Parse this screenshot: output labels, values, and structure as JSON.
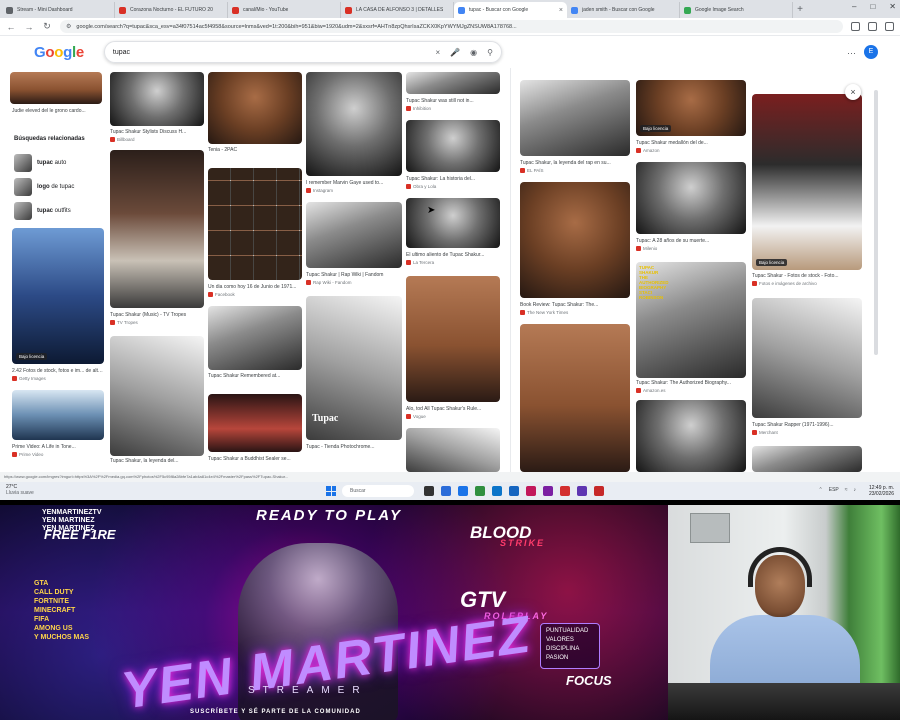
{
  "browser": {
    "tabs": [
      {
        "label": "Stream - Mini Dashboard",
        "color": "#5f6368"
      },
      {
        "label": "Corazona Nocturno - EL FUTURO 20",
        "color": "#d93025"
      },
      {
        "label": "canal/Mio - YouTube",
        "color": "#d93025"
      },
      {
        "label": "LA CASA DE ALFONSO 3 | DETALLES",
        "color": "#d93025"
      },
      {
        "label": "tupac - Buscar con Google",
        "color": "#4285f4",
        "active": true
      },
      {
        "label": "jaden smith - Buscar con Google",
        "color": "#4285f4"
      },
      {
        "label": "Google Image Search",
        "color": "#34a853"
      }
    ],
    "url": "google.com/search?q=tupac&sca_esv=a34f07514ac5f4958&source=lnms&ved=1t:200&bih=951&biw=1920&udm=2&sxsrf=AHTn8zpQhsrIsaZCKX0KpYWYMJgZNSUW8A178768...",
    "tab_close": "×",
    "new_tab": "+"
  },
  "google": {
    "logo_letters": [
      "G",
      "o",
      "o",
      "g",
      "l",
      "e"
    ],
    "query": "tupac",
    "clear_icon": "×",
    "avatar_letter": "E"
  },
  "results": {
    "left_top_caption": "Judie eleved del le grono cardo...",
    "related_title": "Búsquedas relacionadas",
    "related": [
      {
        "bold": "tupac",
        "rest": " auto"
      },
      {
        "bold": "logo",
        "rest": " de tupac"
      },
      {
        "bold": "tupac",
        "rest": " outfits"
      }
    ],
    "items": [
      {
        "caption": "Tupac Shakur Stylists Discuss H...",
        "source": "Billboard",
        "badge": ""
      },
      {
        "caption": "Tupac Shakur (Music) - TV Tropes",
        "source": "TV Tropes",
        "badge": ""
      },
      {
        "caption": "2.42 Fotos de stock, fotos e im... de alta...",
        "source": "Getty Images",
        "badge": "Bajo licencia"
      },
      {
        "caption": "Prime Video: A Life in Tone...",
        "source": "Prime Video",
        "badge": ""
      },
      {
        "caption": "Tupac Shakur, la leyenda del...",
        "source": "El País",
        "badge": ""
      },
      {
        "caption": "Tenia - 2PAC",
        "source": "2PAC",
        "badge": ""
      },
      {
        "caption": "Un dia como hoy 16 de Junio de 1971...",
        "source": "Facebook",
        "badge": ""
      },
      {
        "caption": "Tupac Shakur Remembered at...",
        "source": "Rolling Stone",
        "badge": ""
      },
      {
        "caption": "Tupac Shakur a Buddhist Sealer se...",
        "source": "Lion's Roar",
        "badge": ""
      },
      {
        "caption": "I remember Marvin Gaye used to...",
        "source": "Instagram",
        "badge": ""
      },
      {
        "caption": "Tupac Shakur | Rap Wiki | Fandom",
        "source": "Rap Wiki - Fandom",
        "badge": ""
      },
      {
        "caption": "Tupac - Tienda Photochrome...",
        "source": "Pinterest",
        "badge": ""
      },
      {
        "caption": "Tupac Shakur was still not in...",
        "source": "Inhibition",
        "badge": ""
      },
      {
        "caption": "Tupac Shakur: La historia del...",
        "source": "Obra y Lola",
        "badge": ""
      },
      {
        "caption": "El ultimo aliento de Tupac Shakur...",
        "source": "La Tercera",
        "badge": ""
      },
      {
        "caption": "Alo, tod All Tupac Shakur's Rule...",
        "source": "Vogue",
        "badge": ""
      },
      {
        "caption": "Tupac Shakur, la leyenda del rap en su...",
        "source": "EL PAÍS",
        "badge": ""
      },
      {
        "caption": "Book Review: Tupac Shakur: The...",
        "source": "The New York Times",
        "badge": ""
      },
      {
        "caption": "Tupac Shakur medallón del de...",
        "source": "Amazon",
        "badge": "Bajo licencia"
      },
      {
        "caption": "Tupac: A 28 años de su muerte...",
        "source": "Milenio",
        "badge": ""
      },
      {
        "caption": "Tupac Shakur: The Authorized Biography...",
        "source": "Amazon.es",
        "badge": ""
      },
      {
        "caption": "Tupac Shakur - Fotos de stock - Foto...",
        "source": "Fotos e imágenes de archivo",
        "badge": "Bajo licencia"
      },
      {
        "caption": "Tupac Shakur Rapper (1971-1996)...",
        "source": "Merchant",
        "badge": ""
      }
    ],
    "cover_text": [
      "TUPAC",
      "SHAKUR",
      "THE",
      "AUTHORIZED",
      "BIOGRAPHY",
      "STACI",
      "ROBINSON"
    ],
    "tupac_label": "Tupac",
    "panel_close": "×",
    "statusbar": "https://www.google.com/imgres?imgurl=https%3A%2F%2Fmedia.gq.com%2Fphotos%2F5c95f8a28bfe7a1ab4a81c4e4%2Fmaster%2Fpass%2FTupac-Shakur..."
  },
  "taskbar": {
    "weather_temp": "27°C",
    "weather_desc": "Lluvia suave",
    "search_placeholder": "Buscar",
    "lang": "ESP",
    "time": "12:49 p. m.",
    "date": "23/02/2026",
    "app_colors": [
      "#333",
      "#2b6cd9",
      "#1a73e8",
      "#2f8f3f",
      "#0b74c9",
      "#1565c0",
      "#c2185b",
      "#7b1fa2",
      "#d32f2f",
      "#5e35b1",
      "#c62828"
    ]
  },
  "stream": {
    "list_left": [
      "YENMARTINEZTV",
      "YEN MARTINEZ",
      "YEN MARTINEZ"
    ],
    "ready": "READY TO PLAY",
    "freefire": "FREE F1RE",
    "blood": "BLOOD",
    "strike": "STRIKE",
    "games_left": [
      "GTA",
      "CALL DUTY",
      "FORTNITE",
      "MINECRAFT",
      "FIFA",
      "AMONG US",
      "Y MUCHOS MAS"
    ],
    "gtv": "GTV",
    "roleplay": "ROLEPLAY",
    "name": "YEN MARTINEZ",
    "streamer": "STREAMER",
    "values": [
      "PUNTUALIDAD",
      "VALORES",
      "DISCIPLINA",
      "PASION"
    ],
    "focus": "FOCUS",
    "footer": "SUSCRÍBETE Y SÉ PARTE DE LA COMUNIDAD"
  }
}
